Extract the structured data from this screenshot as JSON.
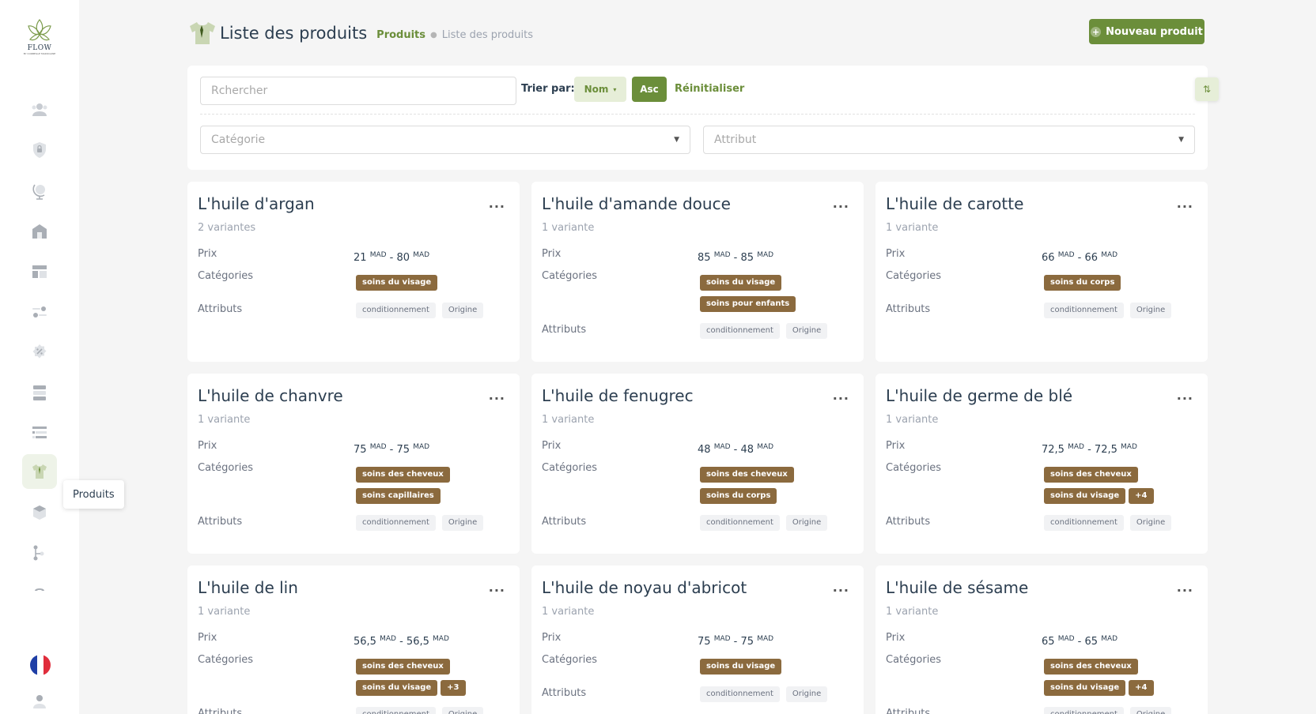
{
  "app": {
    "logo_text": "FLOW",
    "logo_subtext": "BY CORBEILLE MAROCAINE"
  },
  "sidebar": {
    "icons": [
      "users-icon",
      "shield-lock-icon",
      "globe-icon",
      "warehouse-icon",
      "layout-icon",
      "settings-sliders-icon",
      "badge-percent-icon",
      "server-icon",
      "list-icon",
      "shirt-icon",
      "box-icon",
      "tree-icon",
      "cropped-icon",
      "france-flag-icon",
      "user-icon"
    ],
    "active_tooltip": "Produits"
  },
  "header": {
    "title": "Liste des produits",
    "breadcrumb": [
      "Produits",
      "Liste des produits"
    ],
    "new_button_label": "Nouveau produit"
  },
  "filters": {
    "search_placeholder": "Rchercher",
    "sort_label": "Trier par:",
    "sort_value": "Nom",
    "order_label": "Asc",
    "reset_label": "Réinitialiser",
    "category_placeholder": "Catégorie",
    "attribute_placeholder": "Attribut"
  },
  "labels": {
    "price": "Prix",
    "categories": "Catégories",
    "attributes": "Attributs",
    "currency": "MAD",
    "menu": "..."
  },
  "products": [
    {
      "name": "L'huile d'argan",
      "variants": "2 variantes",
      "price_min": "21",
      "price_max": "80",
      "categories": [
        "soins du visage"
      ],
      "extra": "",
      "attributes": [
        "conditionnement",
        "Origine"
      ]
    },
    {
      "name": "L'huile d'amande douce",
      "variants": "1 variante",
      "price_min": "85",
      "price_max": "85",
      "categories": [
        "soins du visage",
        "soins pour enfants"
      ],
      "extra": "",
      "attributes": [
        "conditionnement",
        "Origine"
      ]
    },
    {
      "name": "L'huile de carotte",
      "variants": "1 variante",
      "price_min": "66",
      "price_max": "66",
      "categories": [
        "soins du corps"
      ],
      "extra": "",
      "attributes": [
        "conditionnement",
        "Origine"
      ]
    },
    {
      "name": "L'huile de chanvre",
      "variants": "1 variante",
      "price_min": "75",
      "price_max": "75",
      "categories": [
        "soins des cheveux",
        "soins capillaires"
      ],
      "extra": "",
      "attributes": [
        "conditionnement",
        "Origine"
      ]
    },
    {
      "name": "L'huile de fenugrec",
      "variants": "1 variante",
      "price_min": "48",
      "price_max": "48",
      "categories": [
        "soins des cheveux",
        "soins du corps"
      ],
      "extra": "",
      "attributes": [
        "conditionnement",
        "Origine"
      ]
    },
    {
      "name": "L'huile de germe de blé",
      "variants": "1 variante",
      "price_min": "72,5",
      "price_max": "72,5",
      "categories": [
        "soins des cheveux",
        "soins du visage"
      ],
      "extra": "+4",
      "attributes": [
        "conditionnement",
        "Origine"
      ]
    },
    {
      "name": "L'huile de lin",
      "variants": "1 variante",
      "price_min": "56,5",
      "price_max": "56,5",
      "categories": [
        "soins des cheveux",
        "soins du visage"
      ],
      "extra": "+3",
      "attributes": [
        "conditionnement",
        "Origine"
      ]
    },
    {
      "name": "L'huile de noyau d'abricot",
      "variants": "1 variante",
      "price_min": "75",
      "price_max": "75",
      "categories": [
        "soins du visage"
      ],
      "extra": "",
      "attributes": [
        "conditionnement",
        "Origine"
      ]
    },
    {
      "name": "L'huile de sésame",
      "variants": "1 variante",
      "price_min": "65",
      "price_max": "65",
      "categories": [
        "soins des cheveux",
        "soins du visage"
      ],
      "extra": "+4",
      "attributes": [
        "conditionnement",
        "Origine"
      ]
    }
  ],
  "colors": {
    "primary": "#6b8e3a",
    "primary_light": "#e6eed8",
    "category_tag": "#8b6a3e",
    "attribute_tag": "#f1f2f4",
    "background": "#f5f5f5"
  }
}
